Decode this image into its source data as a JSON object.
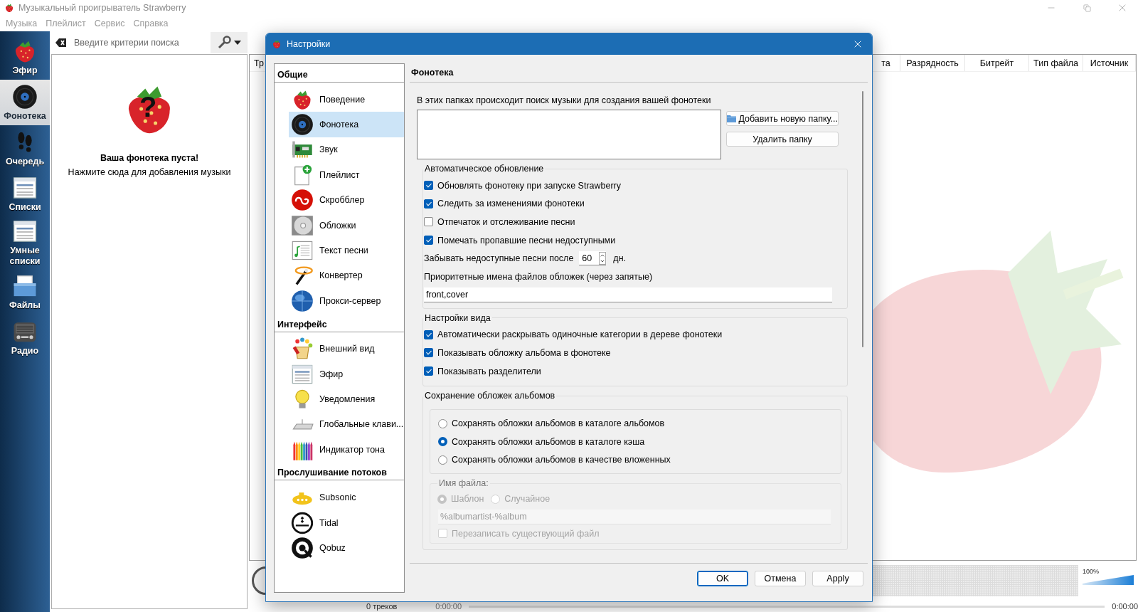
{
  "window": {
    "title": "Музыкальный проигрыватель Strawberry"
  },
  "menu": [
    "Музыка",
    "Плейлист",
    "Сервис",
    "Справка"
  ],
  "sidebar": {
    "items": [
      {
        "label": "Эфир",
        "selected": false
      },
      {
        "label": "Фонотека",
        "selected": true
      },
      {
        "label": "Очередь",
        "selected": false
      },
      {
        "label": "Списки",
        "selected": false
      },
      {
        "label": "Умные списки",
        "selected": false
      },
      {
        "label": "Файлы",
        "selected": false
      },
      {
        "label": "Радио",
        "selected": false
      }
    ]
  },
  "library": {
    "search": {
      "placeholder": "Введите критерии поиска"
    },
    "empty_mark": "?",
    "empty_title": "Ваша фонотека пуста!",
    "empty_hint": "Нажмите сюда для добавления музыки"
  },
  "playlist": {
    "columns": [
      "Тр",
      "та",
      "Разрядность",
      "Битрейт",
      "Тип файла",
      "Источник"
    ],
    "track_count": "0 треков",
    "position": "0:00:00",
    "volume": {
      "reading": "100%",
      "level": 1
    },
    "elapsed": "0:00:00"
  },
  "dialog": {
    "title": "Настройки",
    "nav": {
      "sections": [
        {
          "title": "Общие",
          "items": [
            {
              "label": "Поведение",
              "selected": false
            },
            {
              "label": "Фонотека",
              "selected": true
            },
            {
              "label": "Звук",
              "selected": false
            },
            {
              "label": "Плейлист",
              "selected": false
            },
            {
              "label": "Скробблер",
              "selected": false
            },
            {
              "label": "Обложки",
              "selected": false
            },
            {
              "label": "Текст песни",
              "selected": false
            },
            {
              "label": "Конвертер",
              "selected": false
            },
            {
              "label": "Прокси-сервер",
              "selected": false
            }
          ]
        },
        {
          "title": "Интерфейс",
          "items": [
            {
              "label": "Внешний вид",
              "selected": false
            },
            {
              "label": "Эфир",
              "selected": false
            },
            {
              "label": "Уведомления",
              "selected": false
            },
            {
              "label": "Глобальные клави...",
              "selected": false
            },
            {
              "label": "Индикатор тона",
              "selected": false
            }
          ]
        },
        {
          "title": "Прослушивание потоков",
          "items": [
            {
              "label": "Subsonic",
              "selected": false
            },
            {
              "label": "Tidal",
              "selected": false
            },
            {
              "label": "Qobuz",
              "selected": false
            }
          ]
        }
      ]
    },
    "page": {
      "heading": "Фонотека",
      "folders_label": "В этих папках происходит поиск музыки для создания вашей фонотеки",
      "add_folder_button": "Добавить новую папку...",
      "remove_folder_button": "Удалить папку",
      "auto_update": {
        "title": "Автоматическое обновление",
        "options": [
          {
            "label": "Обновлять фонотеку при запуске Strawberry",
            "checked": true
          },
          {
            "label": "Следить за изменениями фонотеки",
            "checked": true
          },
          {
            "label": "Отпечаток и отслеживание песни",
            "checked": false
          },
          {
            "label": "Помечать пропавшие песни недоступными",
            "checked": true
          }
        ],
        "forget_label": "Забывать недоступные песни после",
        "forget_value": "60",
        "forget_unit": "дн.",
        "cover_names_label": "Приоритетные имена файлов обложек (через запятые)",
        "cover_names_value": "front,cover"
      },
      "view": {
        "title": "Настройки вида",
        "options": [
          {
            "label": "Автоматически раскрывать одиночные категории в дереве фонотеки",
            "checked": true
          },
          {
            "label": "Показывать обложку альбома в фонотеке",
            "checked": true
          },
          {
            "label": "Показывать разделители",
            "checked": true
          }
        ]
      },
      "cover_save": {
        "title": "Сохранение обложек альбомов",
        "modes": [
          {
            "label": "Сохранять обложки альбомов в каталоге альбомов",
            "selected": false
          },
          {
            "label": "Сохранять обложки альбомов в каталоге кэша",
            "selected": true
          },
          {
            "label": "Сохранять обложки альбомов в качестве вложенных",
            "selected": false
          }
        ],
        "filename": {
          "title": "Имя файла:",
          "disabled": true,
          "modes": [
            {
              "label": "Шаблон",
              "selected": true
            },
            {
              "label": "Случайное",
              "selected": false
            }
          ],
          "pattern": "%albumartist-%album",
          "overwrite": {
            "label": "Перезаписать существующий файл",
            "checked": false
          }
        }
      }
    },
    "buttons": [
      {
        "label": "OK",
        "default": true
      },
      {
        "label": "Отмена",
        "default": false
      },
      {
        "label": "Apply",
        "default": false
      }
    ]
  }
}
